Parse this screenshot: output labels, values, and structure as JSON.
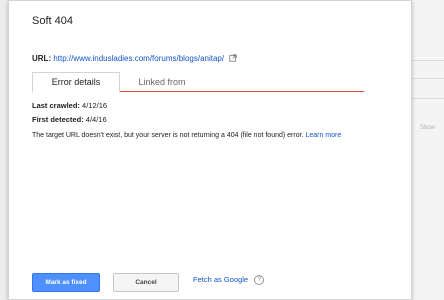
{
  "dialog": {
    "title": "Soft 404",
    "url_label": "URL:",
    "url_value": "http://www.indusladies.com/forums/blogs/anitap/",
    "tabs": [
      {
        "label": "Error details",
        "active": true
      },
      {
        "label": "Linked from",
        "active": false
      }
    ],
    "last_crawled_label": "Last crawled:",
    "last_crawled_value": "4/12/16",
    "first_detected_label": "First detected:",
    "first_detected_value": "4/4/16",
    "description": "The target URL doesn't exist, but your server is not returning a 404 (file not found) error.",
    "learn_more": "Learn more",
    "mark_fixed_label": "Mark as fixed",
    "cancel_label": "Cancel",
    "fetch_label": "Fetch as Google",
    "help_glyph": "?"
  },
  "background": {
    "partial_text": "Show"
  },
  "colors": {
    "accent_tab_line": "#dd4b39",
    "primary_button": "#4d90fe",
    "link": "#1155cc"
  }
}
